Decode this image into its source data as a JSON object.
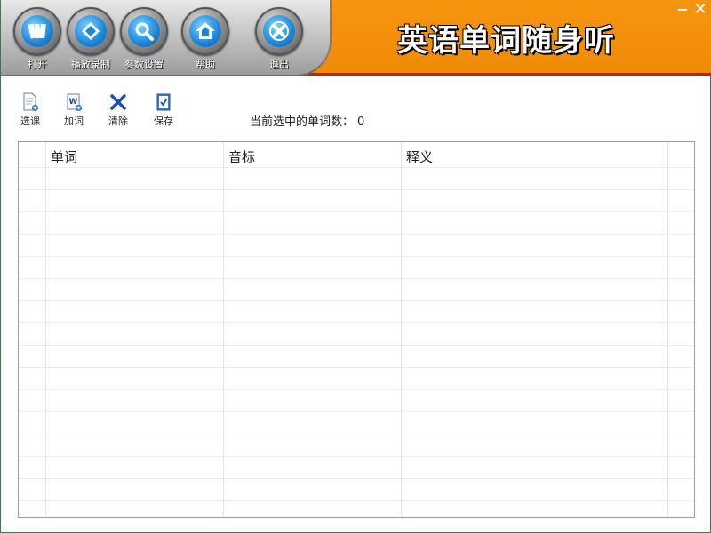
{
  "app": {
    "title": "英语单词随身听",
    "minimize_glyph": "−",
    "close_glyph": "✕"
  },
  "main_toolbar": [
    {
      "label": "打开",
      "icon": "open-cards-icon"
    },
    {
      "label": "播放录制",
      "icon": "play-record-icon"
    },
    {
      "label": "参数设置",
      "icon": "magnifier-settings-icon"
    },
    {
      "label": "帮助",
      "icon": "house-help-icon"
    },
    {
      "label": "退出",
      "icon": "exit-x-icon"
    }
  ],
  "word_toolbar": [
    {
      "label": "选课",
      "icon": "select-lesson-icon"
    },
    {
      "label": "加词",
      "icon": "add-word-icon"
    },
    {
      "label": "清除",
      "icon": "clear-x-icon"
    },
    {
      "label": "保存",
      "icon": "save-checklist-icon"
    }
  ],
  "status": {
    "label": "当前选中的单词数：",
    "count": "0"
  },
  "table": {
    "columns": [
      "单词",
      "音标",
      "释义"
    ],
    "rows": []
  },
  "colors": {
    "header_orange": "#f08a08",
    "accent_blue": "#1a86d9",
    "border_green": "#3a7a4a"
  }
}
